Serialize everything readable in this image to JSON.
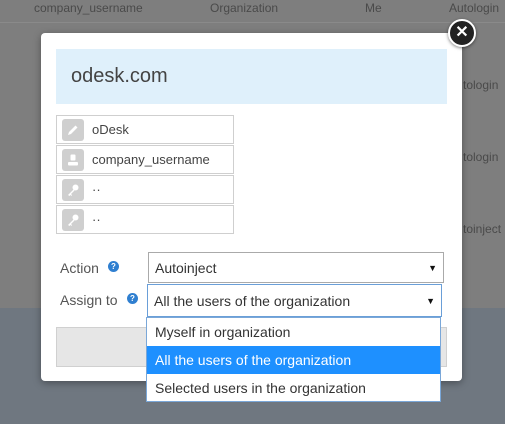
{
  "background_table": {
    "header": {
      "col1": "company_username",
      "col2": "Organization",
      "col3": "Me",
      "col4": "Autologin"
    },
    "peek_cells": [
      "tologin",
      "tologin",
      "toinject"
    ]
  },
  "modal": {
    "title": "odesk.com",
    "close_icon": "close-icon",
    "fields": [
      {
        "icon": "pencil-icon",
        "value": "oDesk"
      },
      {
        "icon": "user-icon",
        "value": "company_username"
      },
      {
        "icon": "key-icon",
        "value": "··"
      },
      {
        "icon": "key-icon",
        "value": "··"
      }
    ],
    "action": {
      "label": "Action",
      "help_icon": "help-icon",
      "selected": "Autoinject"
    },
    "assign_to": {
      "label": "Assign to",
      "help_icon": "help-icon",
      "selected": "All the users of the organization",
      "options": [
        "Myself in organization",
        "All the users of the organization",
        "Selected users in the organization"
      ],
      "selected_index": 1
    }
  },
  "colors": {
    "title_bg": "#dff0fb",
    "highlight": "#1e90ff",
    "help_icon": "#2f7fd0"
  }
}
